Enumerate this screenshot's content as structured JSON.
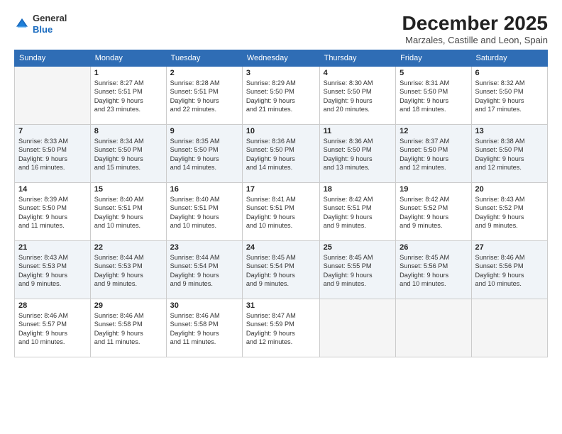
{
  "logo": {
    "general": "General",
    "blue": "Blue"
  },
  "title": "December 2025",
  "subtitle": "Marzales, Castille and Leon, Spain",
  "days_header": [
    "Sunday",
    "Monday",
    "Tuesday",
    "Wednesday",
    "Thursday",
    "Friday",
    "Saturday"
  ],
  "weeks": [
    [
      {
        "num": "",
        "detail": ""
      },
      {
        "num": "1",
        "detail": "Sunrise: 8:27 AM\nSunset: 5:51 PM\nDaylight: 9 hours\nand 23 minutes."
      },
      {
        "num": "2",
        "detail": "Sunrise: 8:28 AM\nSunset: 5:51 PM\nDaylight: 9 hours\nand 22 minutes."
      },
      {
        "num": "3",
        "detail": "Sunrise: 8:29 AM\nSunset: 5:50 PM\nDaylight: 9 hours\nand 21 minutes."
      },
      {
        "num": "4",
        "detail": "Sunrise: 8:30 AM\nSunset: 5:50 PM\nDaylight: 9 hours\nand 20 minutes."
      },
      {
        "num": "5",
        "detail": "Sunrise: 8:31 AM\nSunset: 5:50 PM\nDaylight: 9 hours\nand 18 minutes."
      },
      {
        "num": "6",
        "detail": "Sunrise: 8:32 AM\nSunset: 5:50 PM\nDaylight: 9 hours\nand 17 minutes."
      }
    ],
    [
      {
        "num": "7",
        "detail": "Sunrise: 8:33 AM\nSunset: 5:50 PM\nDaylight: 9 hours\nand 16 minutes."
      },
      {
        "num": "8",
        "detail": "Sunrise: 8:34 AM\nSunset: 5:50 PM\nDaylight: 9 hours\nand 15 minutes."
      },
      {
        "num": "9",
        "detail": "Sunrise: 8:35 AM\nSunset: 5:50 PM\nDaylight: 9 hours\nand 14 minutes."
      },
      {
        "num": "10",
        "detail": "Sunrise: 8:36 AM\nSunset: 5:50 PM\nDaylight: 9 hours\nand 14 minutes."
      },
      {
        "num": "11",
        "detail": "Sunrise: 8:36 AM\nSunset: 5:50 PM\nDaylight: 9 hours\nand 13 minutes."
      },
      {
        "num": "12",
        "detail": "Sunrise: 8:37 AM\nSunset: 5:50 PM\nDaylight: 9 hours\nand 12 minutes."
      },
      {
        "num": "13",
        "detail": "Sunrise: 8:38 AM\nSunset: 5:50 PM\nDaylight: 9 hours\nand 12 minutes."
      }
    ],
    [
      {
        "num": "14",
        "detail": "Sunrise: 8:39 AM\nSunset: 5:50 PM\nDaylight: 9 hours\nand 11 minutes."
      },
      {
        "num": "15",
        "detail": "Sunrise: 8:40 AM\nSunset: 5:51 PM\nDaylight: 9 hours\nand 10 minutes."
      },
      {
        "num": "16",
        "detail": "Sunrise: 8:40 AM\nSunset: 5:51 PM\nDaylight: 9 hours\nand 10 minutes."
      },
      {
        "num": "17",
        "detail": "Sunrise: 8:41 AM\nSunset: 5:51 PM\nDaylight: 9 hours\nand 10 minutes."
      },
      {
        "num": "18",
        "detail": "Sunrise: 8:42 AM\nSunset: 5:51 PM\nDaylight: 9 hours\nand 9 minutes."
      },
      {
        "num": "19",
        "detail": "Sunrise: 8:42 AM\nSunset: 5:52 PM\nDaylight: 9 hours\nand 9 minutes."
      },
      {
        "num": "20",
        "detail": "Sunrise: 8:43 AM\nSunset: 5:52 PM\nDaylight: 9 hours\nand 9 minutes."
      }
    ],
    [
      {
        "num": "21",
        "detail": "Sunrise: 8:43 AM\nSunset: 5:53 PM\nDaylight: 9 hours\nand 9 minutes."
      },
      {
        "num": "22",
        "detail": "Sunrise: 8:44 AM\nSunset: 5:53 PM\nDaylight: 9 hours\nand 9 minutes."
      },
      {
        "num": "23",
        "detail": "Sunrise: 8:44 AM\nSunset: 5:54 PM\nDaylight: 9 hours\nand 9 minutes."
      },
      {
        "num": "24",
        "detail": "Sunrise: 8:45 AM\nSunset: 5:54 PM\nDaylight: 9 hours\nand 9 minutes."
      },
      {
        "num": "25",
        "detail": "Sunrise: 8:45 AM\nSunset: 5:55 PM\nDaylight: 9 hours\nand 9 minutes."
      },
      {
        "num": "26",
        "detail": "Sunrise: 8:45 AM\nSunset: 5:56 PM\nDaylight: 9 hours\nand 10 minutes."
      },
      {
        "num": "27",
        "detail": "Sunrise: 8:46 AM\nSunset: 5:56 PM\nDaylight: 9 hours\nand 10 minutes."
      }
    ],
    [
      {
        "num": "28",
        "detail": "Sunrise: 8:46 AM\nSunset: 5:57 PM\nDaylight: 9 hours\nand 10 minutes."
      },
      {
        "num": "29",
        "detail": "Sunrise: 8:46 AM\nSunset: 5:58 PM\nDaylight: 9 hours\nand 11 minutes."
      },
      {
        "num": "30",
        "detail": "Sunrise: 8:46 AM\nSunset: 5:58 PM\nDaylight: 9 hours\nand 11 minutes."
      },
      {
        "num": "31",
        "detail": "Sunrise: 8:47 AM\nSunset: 5:59 PM\nDaylight: 9 hours\nand 12 minutes."
      },
      {
        "num": "",
        "detail": ""
      },
      {
        "num": "",
        "detail": ""
      },
      {
        "num": "",
        "detail": ""
      }
    ]
  ]
}
